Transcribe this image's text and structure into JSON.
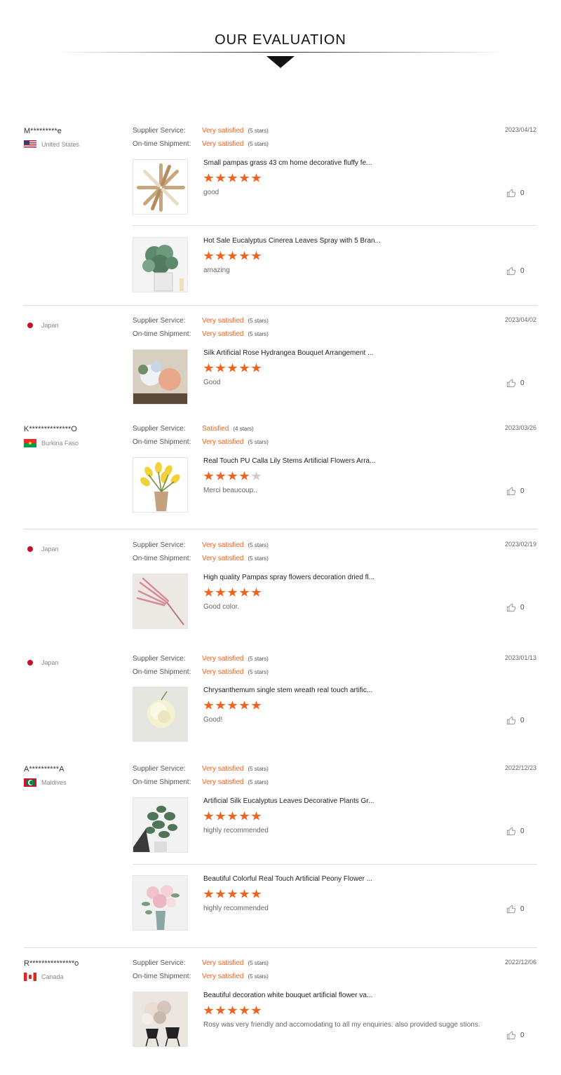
{
  "heading": "OUR EVALUATION",
  "labels": {
    "supplier": "Supplier Service:",
    "shipment": "On-time Shipment:"
  },
  "reviews": [
    {
      "user": "M*********e",
      "country": "United States",
      "date": "2023/04/12",
      "supplier": {
        "text": "Very satisfied",
        "stars": "(5 stars)"
      },
      "shipment": {
        "text": "Very satisfied",
        "stars": "(5 stars)"
      },
      "products": [
        {
          "name": "Small pampas grass 43 cm home decorative fluffy fe...",
          "rating": 5,
          "comment": "good",
          "likes": "0"
        },
        {
          "name": "Hot Sale Eucalyptus Cinerea Leaves Spray with 5 Bran...",
          "rating": 5,
          "comment": "amazing",
          "likes": "0"
        }
      ]
    },
    {
      "user": "",
      "country": "Japan",
      "date": "2023/04/02",
      "supplier": {
        "text": "Very satisfied",
        "stars": "(5 stars)"
      },
      "shipment": {
        "text": "Very satisfied",
        "stars": "(5 stars)"
      },
      "products": [
        {
          "name": "Silk Artificial Rose Hydrangea Bouquet Arrangement ...",
          "rating": 5,
          "comment": "Good",
          "likes": "0"
        }
      ]
    },
    {
      "user": "K**************O",
      "country": "Burkina Faso",
      "date": "2023/03/26",
      "supplier": {
        "text": "Satisfied",
        "stars": "(4 stars)"
      },
      "shipment": {
        "text": "Very satisfied",
        "stars": "(5 stars)"
      },
      "products": [
        {
          "name": "Real Touch PU Calla Lily Stems Artificial Flowers Arra...",
          "rating": 4,
          "comment": "Merci beaucoup..",
          "likes": "0"
        }
      ]
    },
    {
      "user": "",
      "country": "Japan",
      "date": "2023/02/19",
      "supplier": {
        "text": "Very satisfied",
        "stars": "(5 stars)"
      },
      "shipment": {
        "text": "Very satisfied",
        "stars": "(5 stars)"
      },
      "products": [
        {
          "name": "High quality Pampas spray flowers decoration dried fl...",
          "rating": 5,
          "comment": "Good color.",
          "likes": "0"
        }
      ]
    },
    {
      "user": "",
      "country": "Japan",
      "date": "2023/01/13",
      "supplier": {
        "text": "Very satisfied",
        "stars": "(5 stars)"
      },
      "shipment": {
        "text": "Very satisfied",
        "stars": "(5 stars)"
      },
      "products": [
        {
          "name": "Chrysanthemum single stem wreath real touch artific...",
          "rating": 5,
          "comment": "Good!",
          "likes": "0"
        }
      ]
    },
    {
      "user": "A**********A",
      "country": "Maldives",
      "date": "2022/12/23",
      "supplier": {
        "text": "Very satisfied",
        "stars": "(5 stars)"
      },
      "shipment": {
        "text": "Very satisfied",
        "stars": "(5 stars)"
      },
      "products": [
        {
          "name": "Artificial Silk Eucalyptus Leaves Decorative Plants Gr...",
          "rating": 5,
          "comment": "highly recommended",
          "likes": "0"
        },
        {
          "name": "Beautiful Colorful Real Touch Artificial Peony Flower ...",
          "rating": 5,
          "comment": "highly recommended",
          "likes": "0"
        }
      ]
    },
    {
      "user": "R***************o",
      "country": "Canada",
      "date": "2022/12/06",
      "supplier": {
        "text": "Very satisfied",
        "stars": "(5 stars)"
      },
      "shipment": {
        "text": "Very satisfied",
        "stars": "(5 stars)"
      },
      "products": [
        {
          "name": "Beautiful decoration white bouquet artificial flower va...",
          "rating": 5,
          "comment": "Rosy was very friendly and accomodating to all my enquiries. also provided sugge stions.",
          "likes": "0"
        }
      ]
    }
  ]
}
